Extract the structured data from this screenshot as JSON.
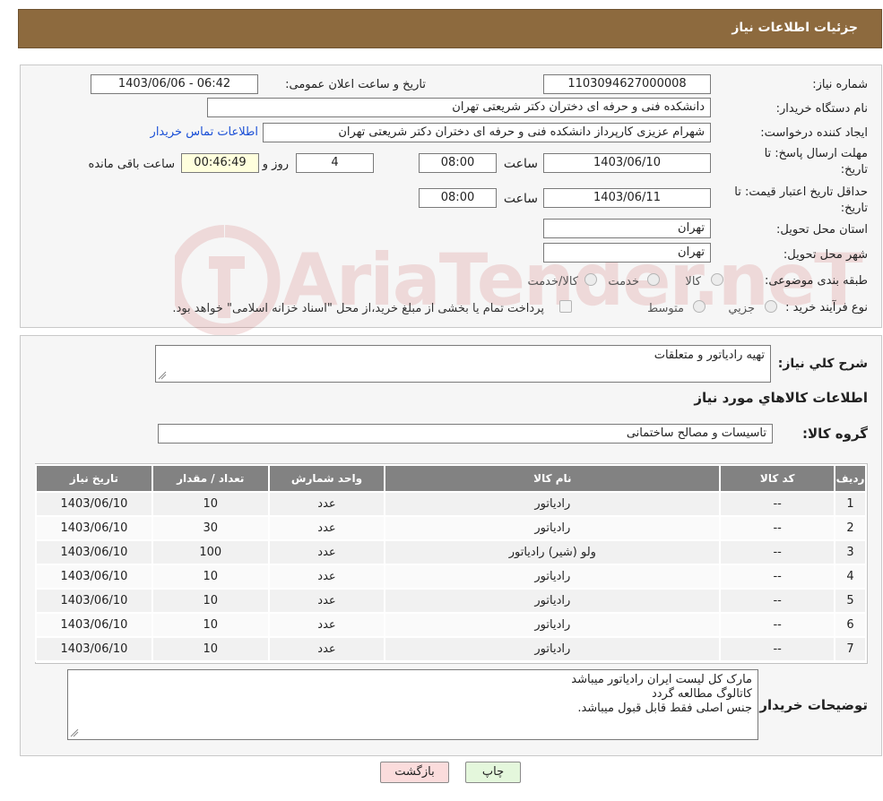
{
  "header": {
    "title": "جزئیات اطلاعات نیاز"
  },
  "info": {
    "need_number": {
      "label": "شماره نیاز:",
      "value": "1103094627000008"
    },
    "announce_datetime": {
      "label": "تاریخ و ساعت اعلان عمومی:",
      "value": "1403/06/06 - 06:42"
    },
    "buyer_org": {
      "label": "نام دستگاه خریدار:",
      "value": "دانشکده فنی و حرفه ای دختران دکتر شریعتی تهران"
    },
    "requester": {
      "label": "ایجاد کننده درخواست:",
      "value": "شهرام عزیزی کارپرداز دانشکده فنی و حرفه ای دختران دکتر شریعتی تهران",
      "contact_link": "اطلاعات تماس خریدار"
    },
    "reply_deadline": {
      "label_1": "مهلت ارسال پاسخ: تا",
      "label_2": "تاریخ:",
      "date": "1403/06/10",
      "time_label": "ساعت",
      "time": "08:00",
      "days": "4",
      "days_label": "روز و",
      "remaining": "00:46:49",
      "remaining_label": "ساعت باقی مانده"
    },
    "price_validity": {
      "label_1": "حداقل تاریخ اعتبار قیمت: تا",
      "label_2": "تاریخ:",
      "date": "1403/06/11",
      "time_label": "ساعت",
      "time": "08:00"
    },
    "delivery_province": {
      "label": "استان محل تحویل:",
      "value": "تهران"
    },
    "delivery_city": {
      "label": "شهر محل تحویل:",
      "value": "تهران"
    },
    "category": {
      "label": "طبقه بندی موضوعی:",
      "options": [
        "کالا",
        "خدمت",
        "کالا/خدمت"
      ]
    },
    "purchase_type": {
      "label": "نوع فرآیند خرید :",
      "options": [
        "جزیي",
        "متوسط"
      ],
      "note": "پرداخت تمام یا بخشی از مبلغ خرید،از محل \"اسناد خزانه اسلامی\" خواهد بود."
    }
  },
  "summary": {
    "general_desc_label": "شرح کلي نياز:",
    "general_desc": "تهیه رادیاتور و متعلقات",
    "goods_info_title": "اطلاعات کالاهاي مورد نياز",
    "goods_group_label": "گروه کالا:",
    "goods_group": "تاسیسات و مصالح ساختمانی"
  },
  "table": {
    "headers": [
      "رديف",
      "کد کالا",
      "نام کالا",
      "واحد شمارش",
      "تعداد / مقدار",
      "تاريخ نياز"
    ],
    "rows": [
      [
        "1",
        "--",
        "رادیاتور",
        "عدد",
        "10",
        "1403/06/10"
      ],
      [
        "2",
        "--",
        "رادیاتور",
        "عدد",
        "30",
        "1403/06/10"
      ],
      [
        "3",
        "--",
        "ولو (شیر) رادیاتور",
        "عدد",
        "100",
        "1403/06/10"
      ],
      [
        "4",
        "--",
        "رادیاتور",
        "عدد",
        "10",
        "1403/06/10"
      ],
      [
        "5",
        "--",
        "رادیاتور",
        "عدد",
        "10",
        "1403/06/10"
      ],
      [
        "6",
        "--",
        "رادیاتور",
        "عدد",
        "10",
        "1403/06/10"
      ],
      [
        "7",
        "--",
        "رادیاتور",
        "عدد",
        "10",
        "1403/06/10"
      ]
    ]
  },
  "buyer_notes": {
    "label": "توضیحات خریدار:",
    "lines": [
      "مارک کل لیست ایران رادیاتور میباشد",
      "کاتالوگ مطالعه گردد",
      "جنس اصلی فقط قابل قبول میباشد."
    ]
  },
  "buttons": {
    "print": "چاپ",
    "back": "بازگشت"
  },
  "watermark": {
    "text": "AriaTender.neT"
  },
  "colors": {
    "header_bg": "#8d6a3e",
    "table_header_bg": "#828282",
    "link": "#1a4fd6",
    "back_button_bg": "#fbdcdc",
    "print_button_bg": "#e4f7dc"
  }
}
